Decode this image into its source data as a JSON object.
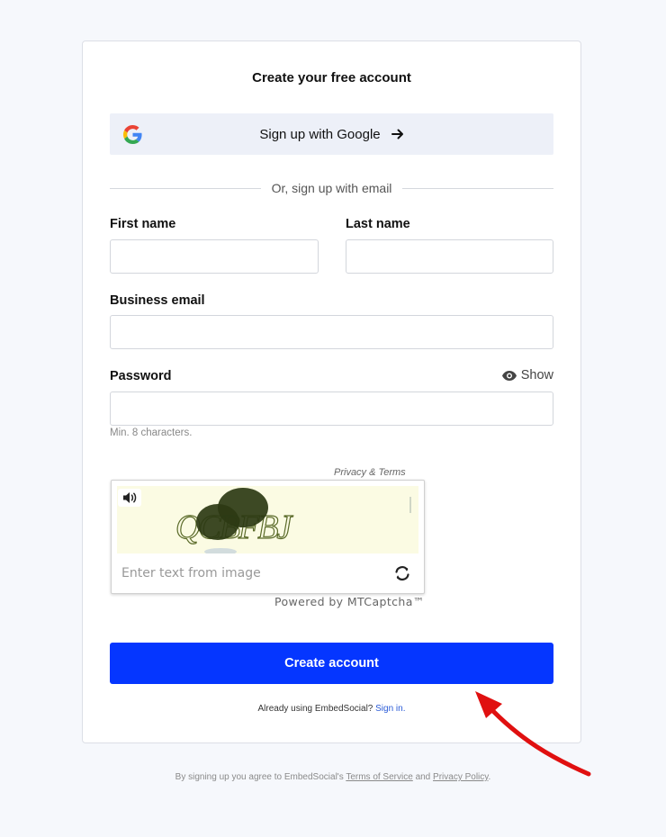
{
  "form": {
    "title": "Create your free account",
    "google_button_label": "Sign up with Google",
    "divider_text": "Or, sign up with email",
    "first_name_label": "First name",
    "last_name_label": "Last name",
    "email_label": "Business email",
    "password_label": "Password",
    "show_label": "Show",
    "password_hint": "Min. 8 characters.",
    "first_name_value": "",
    "last_name_value": "",
    "email_value": "",
    "password_value": ""
  },
  "captcha": {
    "privacy_terms": "Privacy & Terms",
    "image_text": "QCBFBJ",
    "input_placeholder": "Enter text from image",
    "powered_by": "Powered by MTCaptcha™"
  },
  "submit": {
    "label": "Create account"
  },
  "signin": {
    "prefix": "Already using EmbedSocial?",
    "link_label": "Sign in."
  },
  "footer": {
    "prefix": "By signing up you agree to EmbedSocial's",
    "terms_label": "Terms of Service",
    "and_text": "and",
    "privacy_label": "Privacy Policy",
    "suffix": "."
  },
  "colors": {
    "primary_button": "#0536ff",
    "google_button_bg": "#edf0f8",
    "page_bg": "#f6f8fc",
    "annotation_arrow": "#e01010"
  },
  "icons": {
    "google": "google-icon",
    "arrow": "arrow-right-icon",
    "eye": "eye-icon",
    "audio": "speaker-icon",
    "refresh": "refresh-icon"
  }
}
